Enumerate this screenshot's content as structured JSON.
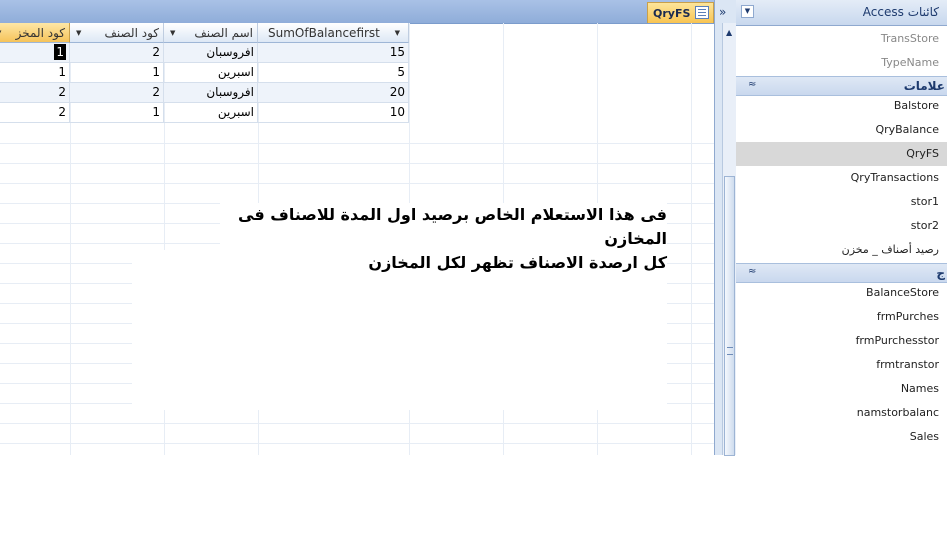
{
  "document_tab": {
    "label": "QryFS",
    "icon": "datasheet-view-icon"
  },
  "grid": {
    "columns": [
      {
        "label": "كود المخز",
        "icon": "filter-dropdown-icon"
      },
      {
        "label": "كود الصنف",
        "icon": "dropdown-arrow-icon"
      },
      {
        "label": "اسم الصنف",
        "icon": "dropdown-arrow-icon"
      },
      {
        "label": "SumOfBalancefirst",
        "icon": "dropdown-arrow-icon"
      }
    ],
    "rows": [
      {
        "store_code": "1",
        "item_code": "2",
        "item_name": "افروسبان",
        "sum": "15"
      },
      {
        "store_code": "1",
        "item_code": "1",
        "item_name": "اسبرين",
        "sum": "5"
      },
      {
        "store_code": "2",
        "item_code": "2",
        "item_name": "افروسبان",
        "sum": "20"
      },
      {
        "store_code": "2",
        "item_code": "1",
        "item_name": "اسبرين",
        "sum": "10"
      }
    ]
  },
  "note": {
    "line1": "فى هذا الاستعلام الخاص برصيد اول المدة للاصناف فى المخازن",
    "line2": "كل ارصدة الاصناف تظهر لكل المخازن"
  },
  "nav_pane": {
    "title": "كائنات Access",
    "top_items": [
      "TransStore",
      "TypeName"
    ],
    "groups": [
      {
        "label": "علامات",
        "items": [
          "Balstore",
          "QryBalance",
          "QryFS",
          "QryTransactions",
          "stor1",
          "stor2",
          "رصيد أصناف _ مخزن"
        ]
      },
      {
        "label": "ج",
        "items": [
          "BalanceStore",
          "frmPurches",
          "frmPurchesstor",
          "frmtranstor",
          "Names",
          "namstorbalanc",
          "Sales"
        ]
      }
    ],
    "selected": "QryFS"
  },
  "colors": {
    "accent": "#f8c452",
    "nav_header": "#c8d8ee",
    "selected_item": "#d8d8d8"
  }
}
